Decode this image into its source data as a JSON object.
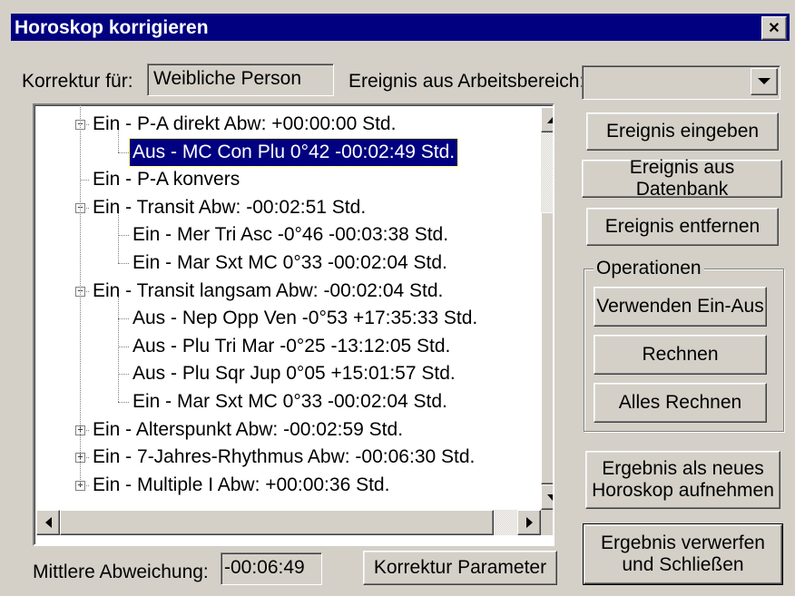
{
  "window": {
    "title": "Horoskop korrigieren",
    "close_symbol": "✕"
  },
  "header": {
    "correction_label": "Korrektur für:",
    "correction_value": "Weibliche Person",
    "event_label": "Ereignis aus Arbeitsbereich:",
    "event_value": ""
  },
  "tree": {
    "nodes": [
      {
        "text": "Ein - P-A direkt  Abw:  +00:00:00 Std.",
        "level": 0,
        "expander": "minus"
      },
      {
        "text": "Aus - MC  Con Plu   0°42  -00:02:49 Std.",
        "level": 1,
        "selected": true
      },
      {
        "text": "Ein - P-A konvers",
        "level": 0
      },
      {
        "text": "Ein - Transit  Abw:  -00:02:51 Std.",
        "level": 0,
        "expander": "minus"
      },
      {
        "text": "Ein - Mer Tri Asc  -0°46  -00:03:38 Std.",
        "level": 1
      },
      {
        "text": "Ein - Mar Sxt MC    0°33  -00:02:04 Std.",
        "level": 1
      },
      {
        "text": "Ein - Transit langsam  Abw:  -00:02:04 Std.",
        "level": 0,
        "expander": "minus"
      },
      {
        "text": "Aus - Nep Opp Ven  -0°53  +17:35:33 Std.",
        "level": 1
      },
      {
        "text": "Aus - Plu Tri Mar  -0°25  -13:12:05 Std.",
        "level": 1
      },
      {
        "text": "Aus - Plu Sqr Jup   0°05  +15:01:57 Std.",
        "level": 1
      },
      {
        "text": "Ein - Mar Sxt MC    0°33  -00:02:04 Std.",
        "level": 1
      },
      {
        "text": "Ein - Alterspunkt  Abw:  -00:02:59 Std.",
        "level": 0,
        "expander": "plus"
      },
      {
        "text": "Ein - 7-Jahres-Rhythmus  Abw:  -00:06:30 Std.",
        "level": 0,
        "expander": "plus"
      },
      {
        "text": "Ein - Multiple I  Abw:  +00:00:36 Std.",
        "level": 0,
        "expander": "plus"
      }
    ]
  },
  "buttons": {
    "enter_event": "Ereignis eingeben",
    "event_from_db": "Ereignis aus Datenbank",
    "remove_event": "Ereignis entfernen",
    "use_in_out": "Verwenden Ein-Aus",
    "calculate": "Rechnen",
    "calculate_all": "Alles Rechnen",
    "result_new_line1": "Ergebnis als neues",
    "result_new_line2": "Horoskop aufnehmen",
    "discard_line1": "Ergebnis verwerfen",
    "discard_line2": "und Schließen",
    "correction_params": "Korrektur Parameter"
  },
  "operations": {
    "title": "Operationen"
  },
  "footer": {
    "mean_dev_label": "Mittlere Abweichung:",
    "mean_dev_value": "-00:06:49"
  },
  "colors": {
    "title_bar": "#000080",
    "face": "#d4d0c8",
    "selection": "#000080"
  }
}
